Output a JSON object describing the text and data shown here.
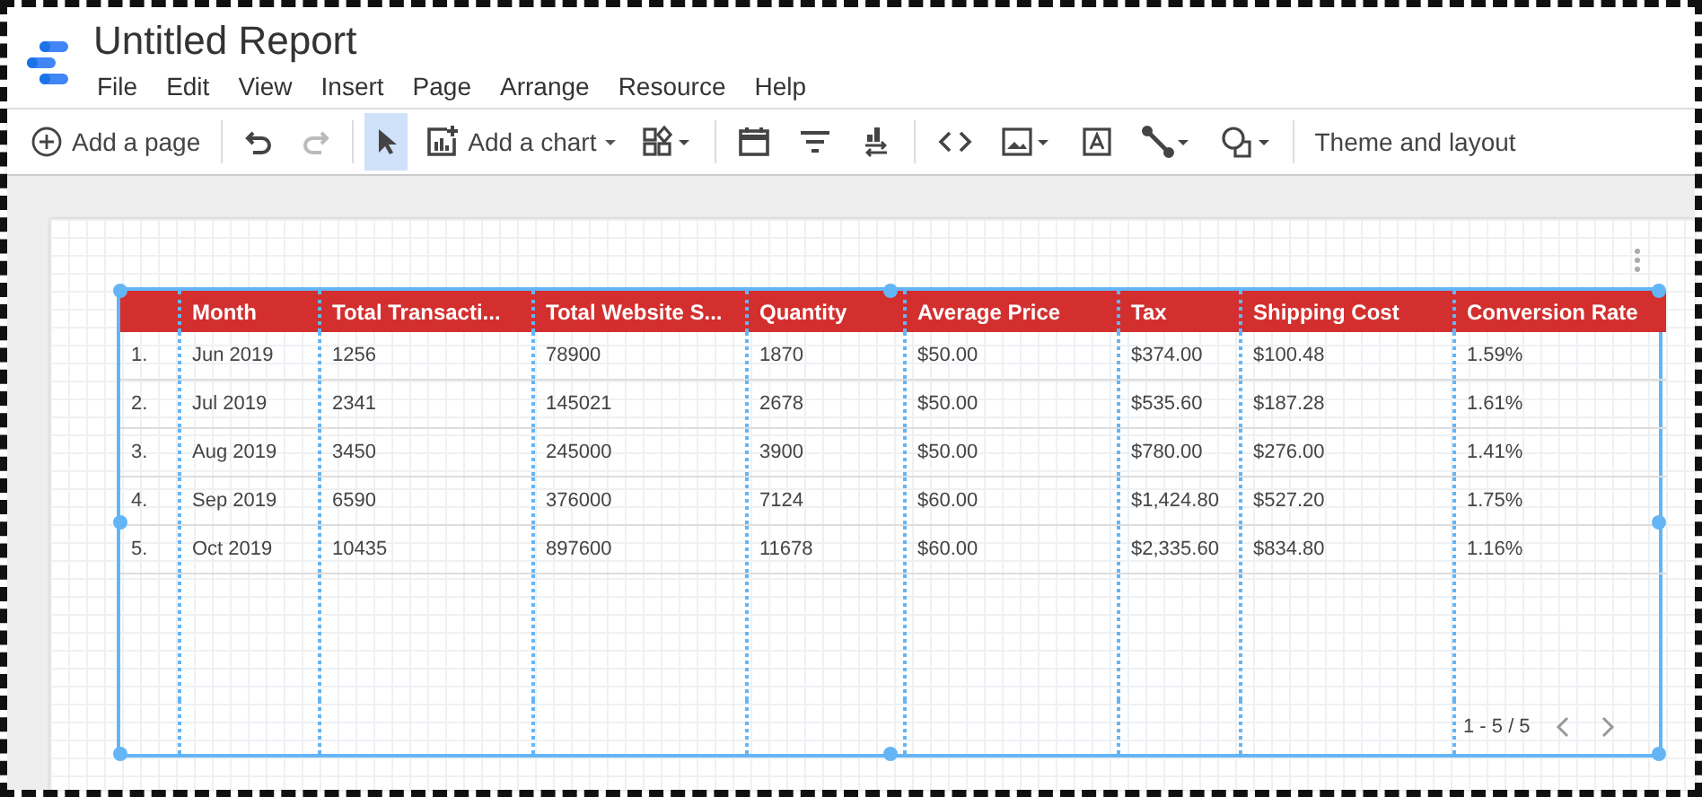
{
  "window": {
    "title": "Untitled Report"
  },
  "menu": [
    "File",
    "Edit",
    "View",
    "Insert",
    "Page",
    "Arrange",
    "Resource",
    "Help"
  ],
  "toolbar": [
    [
      {
        "kind": "add_page",
        "label": "Add a page",
        "selected": false,
        "disabled": false
      }
    ],
    [
      {
        "kind": "undo",
        "selected": false,
        "disabled": false
      },
      {
        "kind": "redo",
        "selected": false,
        "disabled": true
      }
    ],
    [
      {
        "kind": "select",
        "selected": true,
        "disabled": false
      },
      {
        "kind": "add_chart",
        "label": "Add a chart",
        "selected": false,
        "disabled": false
      },
      {
        "kind": "controls",
        "selected": false,
        "disabled": false
      }
    ],
    [
      {
        "kind": "date_range",
        "selected": false,
        "disabled": false
      },
      {
        "kind": "filter",
        "selected": false,
        "disabled": false
      },
      {
        "kind": "data_control",
        "selected": false,
        "disabled": false
      }
    ],
    [
      {
        "kind": "embed",
        "selected": false,
        "disabled": false
      },
      {
        "kind": "image",
        "selected": false,
        "disabled": false
      },
      {
        "kind": "text",
        "selected": false,
        "disabled": false
      },
      {
        "kind": "line",
        "selected": false,
        "disabled": false
      },
      {
        "kind": "shape",
        "selected": false,
        "disabled": false
      }
    ],
    [
      {
        "kind": "theme",
        "label": "Theme and layout",
        "selected": false,
        "disabled": false
      }
    ]
  ],
  "table": {
    "columns": [
      "",
      "Month",
      "Total Transacti...",
      "Total Website S...",
      "Quantity",
      "Average Price",
      "Tax",
      "Shipping Cost",
      "Conversion Rate"
    ],
    "rows": [
      [
        "1.",
        "Jun 2019",
        "1256",
        "78900",
        "1870",
        "$50.00",
        "$374.00",
        "$100.48",
        "1.59%"
      ],
      [
        "2.",
        "Jul 2019",
        "2341",
        "145021",
        "2678",
        "$50.00",
        "$535.60",
        "$187.28",
        "1.61%"
      ],
      [
        "3.",
        "Aug 2019",
        "3450",
        "245000",
        "3900",
        "$50.00",
        "$780.00",
        "$276.00",
        "1.41%"
      ],
      [
        "4.",
        "Sep 2019",
        "6590",
        "376000",
        "7124",
        "$60.00",
        "$1,424.80",
        "$527.20",
        "1.75%"
      ],
      [
        "5.",
        "Oct 2019",
        "10435",
        "897600",
        "11678",
        "$60.00",
        "$2,335.60",
        "$834.80",
        "1.16%"
      ]
    ],
    "pagination": "1 - 5 / 5"
  }
}
